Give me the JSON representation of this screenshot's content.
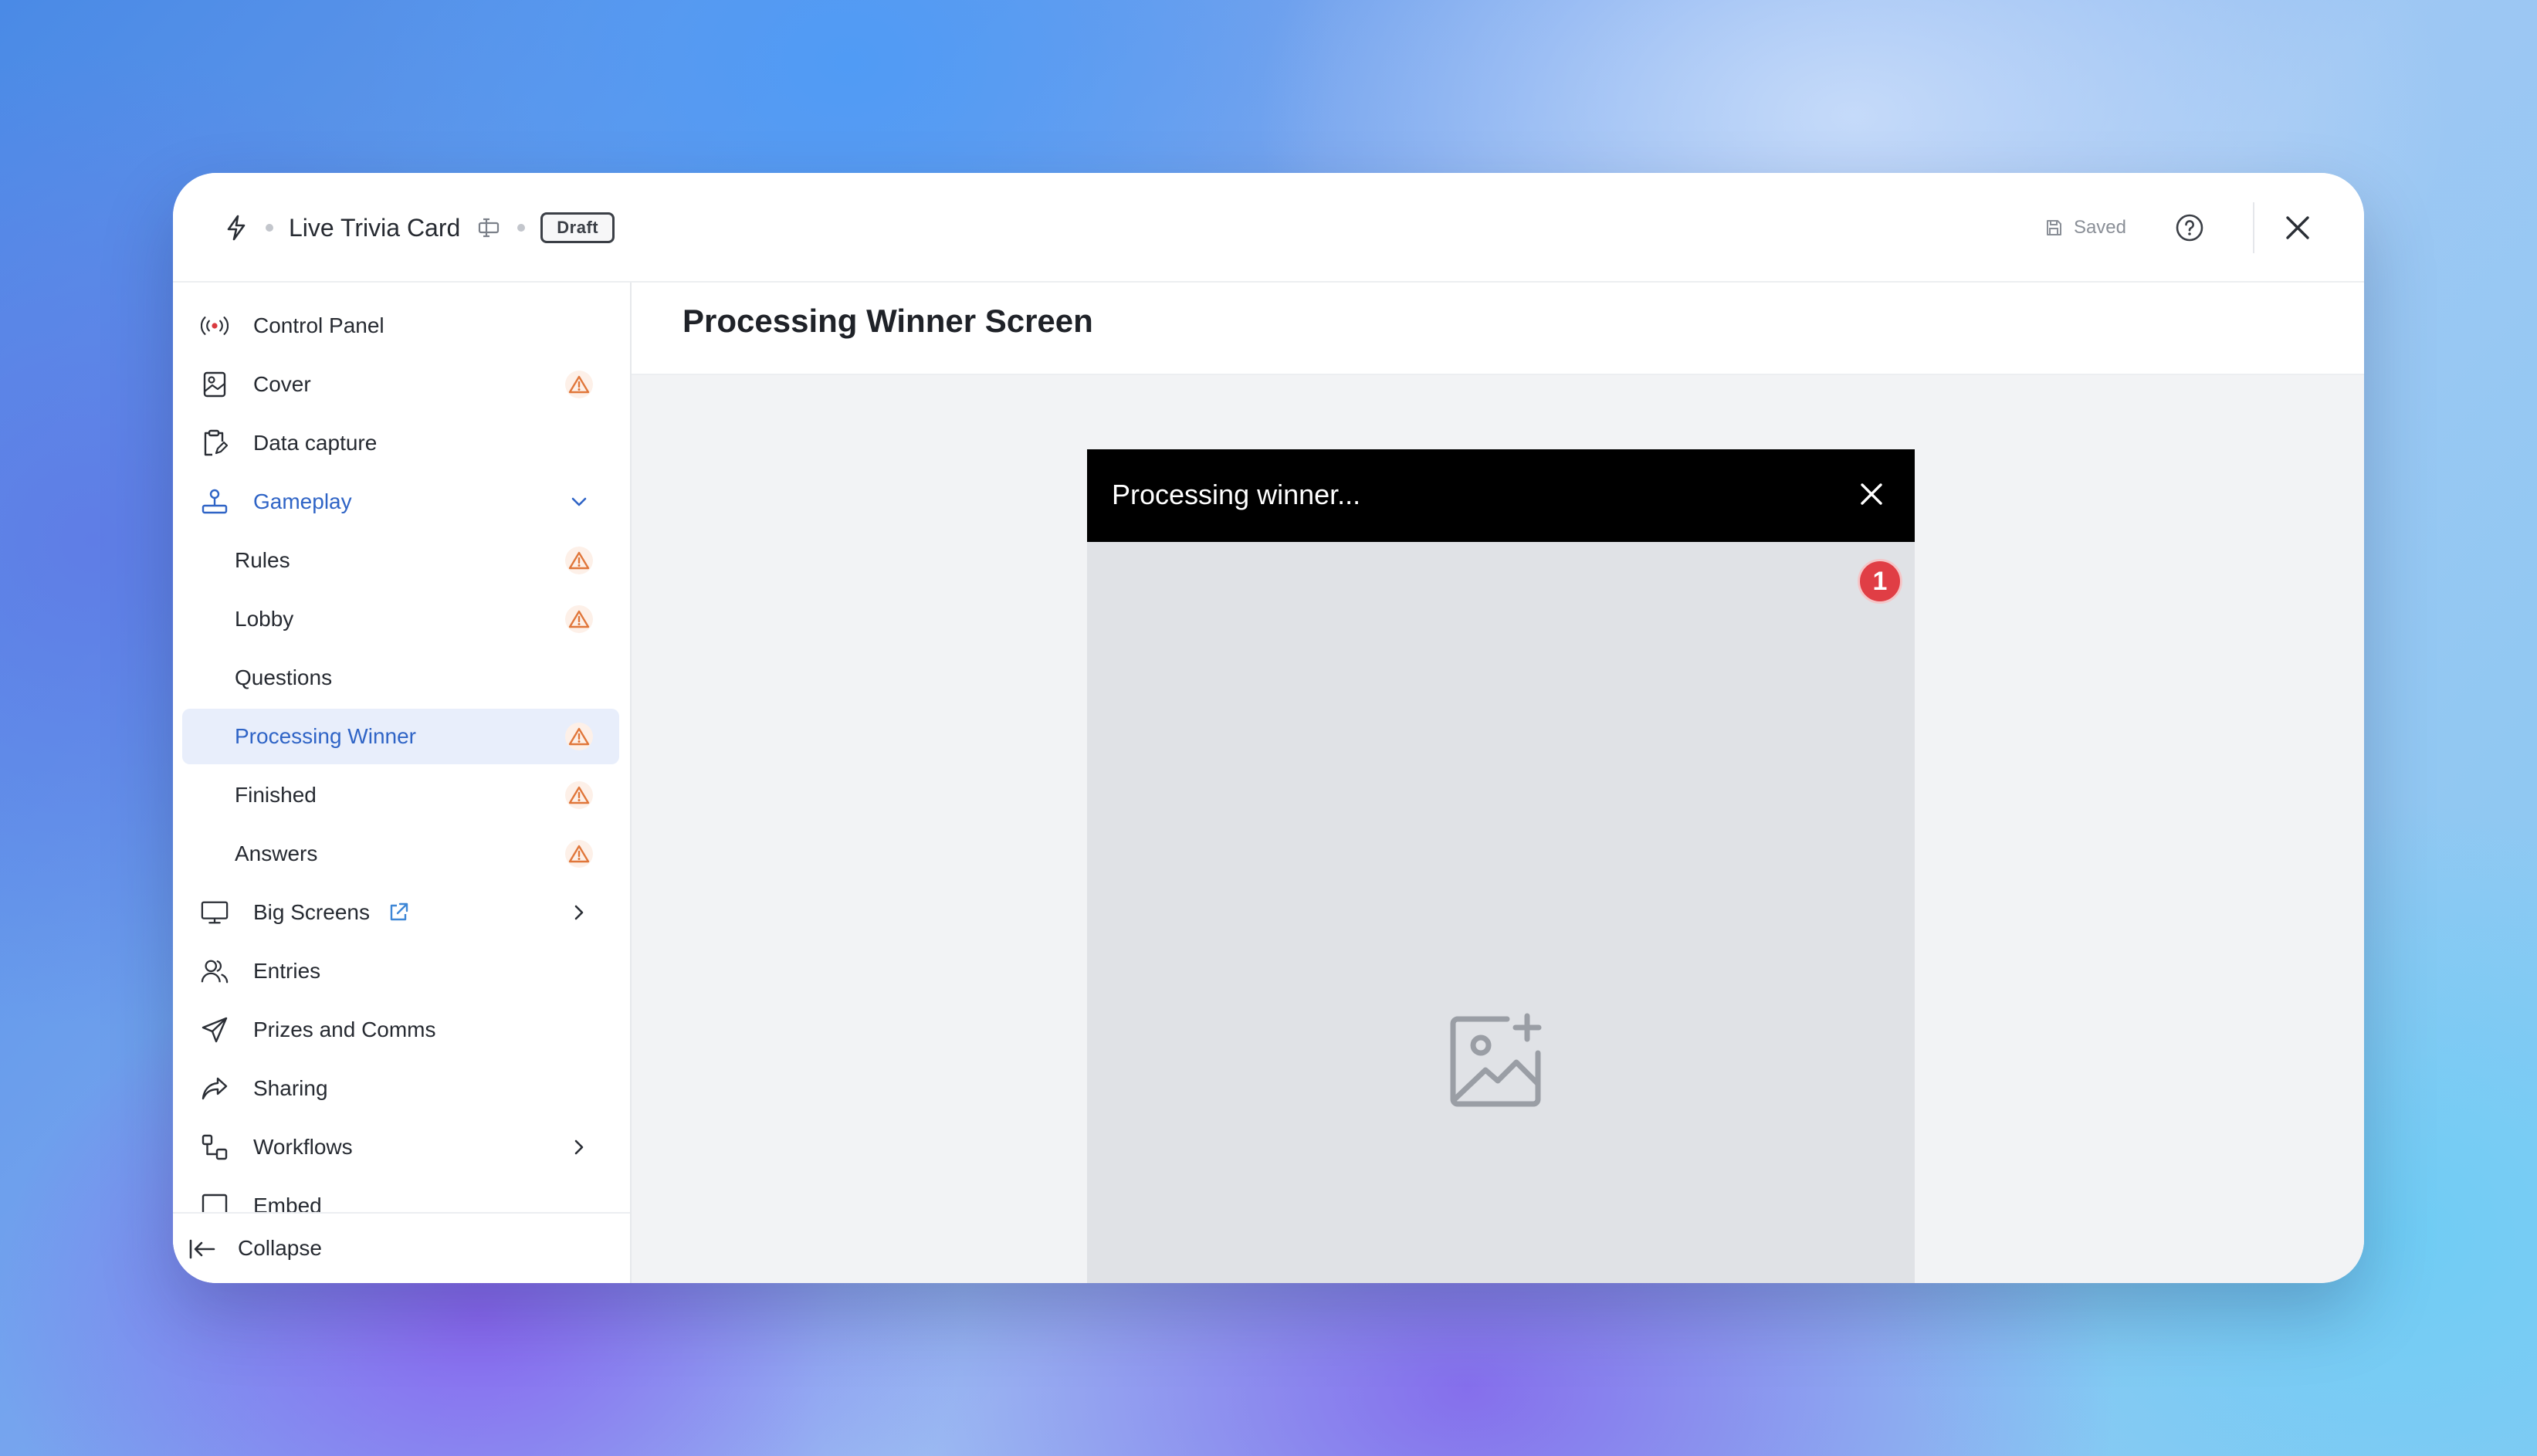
{
  "app": {
    "title": "Live Trivia Card",
    "status_badge": "Draft",
    "saved_label": "Saved"
  },
  "sidebar": {
    "items": [
      {
        "label": "Control Panel",
        "icon": "broadcast-icon"
      },
      {
        "label": "Cover",
        "icon": "image-portrait-icon",
        "warning": true
      },
      {
        "label": "Data capture",
        "icon": "clipboard-edit-icon"
      },
      {
        "label": "Gameplay",
        "icon": "joystick-icon",
        "expanded": true
      },
      {
        "label": "Rules",
        "sub": true,
        "warning": true
      },
      {
        "label": "Lobby",
        "sub": true,
        "warning": true
      },
      {
        "label": "Questions",
        "sub": true
      },
      {
        "label": "Processing Winner",
        "sub": true,
        "warning": true,
        "active": true
      },
      {
        "label": "Finished",
        "sub": true,
        "warning": true
      },
      {
        "label": "Answers",
        "sub": true,
        "warning": true
      },
      {
        "label": "Big Screens",
        "icon": "monitor-icon",
        "external": true
      },
      {
        "label": "Entries",
        "icon": "users-icon"
      },
      {
        "label": "Prizes and Comms",
        "icon": "send-icon"
      },
      {
        "label": "Sharing",
        "icon": "share-icon"
      },
      {
        "label": "Workflows",
        "icon": "workflow-icon"
      },
      {
        "label": "Embed",
        "icon": "embed-icon"
      }
    ],
    "collapse_label": "Collapse"
  },
  "main": {
    "title": "Processing Winner Screen",
    "preview": {
      "header": "Processing winner...",
      "issue_count": "1",
      "placeholder_icon": "image-add-icon"
    }
  },
  "colors": {
    "accent": "#2f64c6",
    "warning": "#e0763a",
    "error_badge": "#e03e45",
    "active_bg": "#e8eefb"
  }
}
